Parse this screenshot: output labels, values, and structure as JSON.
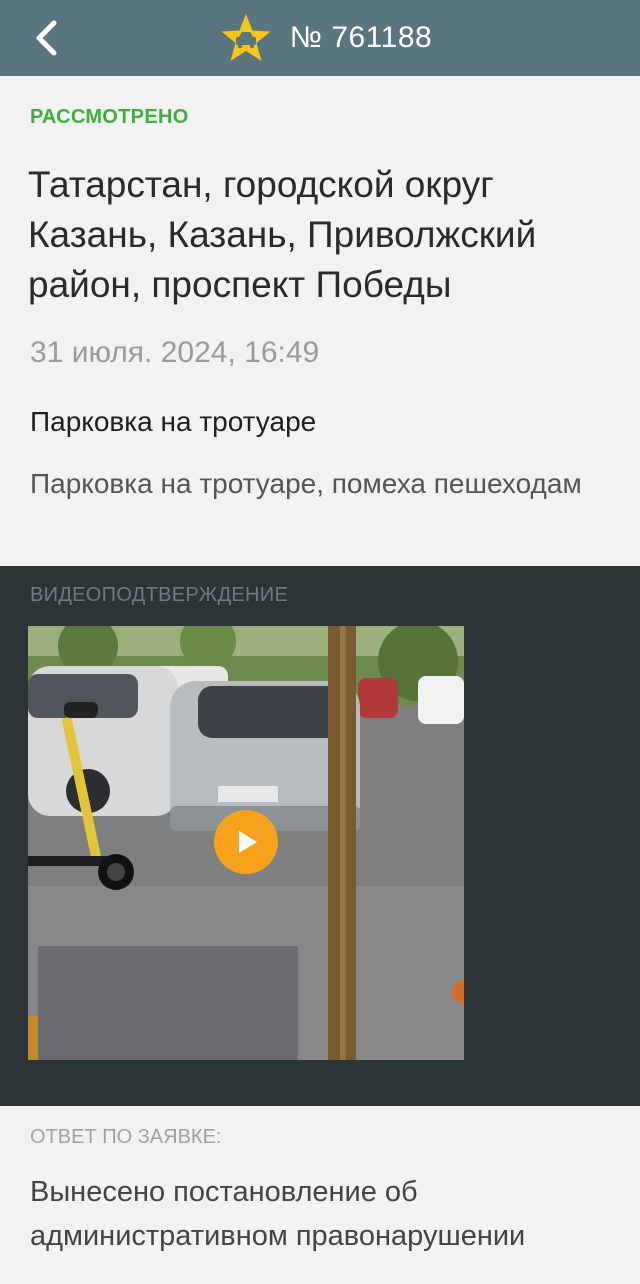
{
  "header": {
    "back_icon": "chevron-left-icon",
    "badge_icon": "star-car-icon",
    "number": "№ 761188",
    "colors": {
      "bar": "#5b7580",
      "star": "#f5c518"
    }
  },
  "report": {
    "status": "РАССМОТРЕНО",
    "address": "Татарстан, городской округ Казань, Казань, Приволжский район, проспект Победы",
    "date": "31 июля. 2024, 16:49",
    "violation_title": "Парковка на тротуаре",
    "violation_description": "Парковка на тротуаре, помеха пешеходам"
  },
  "video": {
    "label": "ВИДЕОПОДТВЕРЖДЕНИЕ",
    "play_icon": "play-icon",
    "colors": {
      "play": "#f7a21b"
    }
  },
  "answer": {
    "label": "ОТВЕТ ПО ЗАЯВКЕ:",
    "text": "Вынесено постановление об административном правонарушении"
  }
}
